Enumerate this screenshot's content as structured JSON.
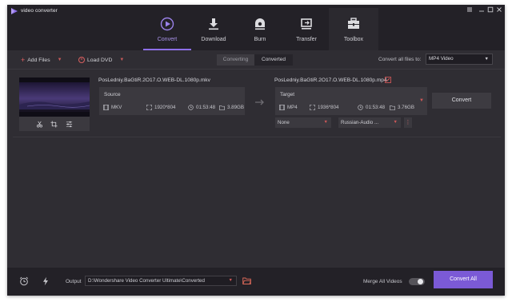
{
  "app": {
    "title": "video converter",
    "accent": "#8d6fe8"
  },
  "window_controls": {
    "menu_icon": "menu-icon",
    "minimize_icon": "minimize-icon",
    "maximize_icon": "maximize-icon",
    "close_icon": "close-icon"
  },
  "nav": {
    "tabs": [
      {
        "label": "Convert",
        "icon": "convert-icon",
        "active": true
      },
      {
        "label": "Download",
        "icon": "download-icon",
        "active": false
      },
      {
        "label": "Burn",
        "icon": "burn-icon",
        "active": false
      },
      {
        "label": "Transfer",
        "icon": "transfer-icon",
        "active": false
      },
      {
        "label": "Toolbox",
        "icon": "toolbox-icon",
        "active": false
      }
    ]
  },
  "toolbar": {
    "add_files": "Add Files",
    "load_dvd": "Load DVD",
    "seg_converting": "Converting",
    "seg_converted": "Converted",
    "convert_all_label": "Convert all files to:",
    "format": "MP4 Video"
  },
  "file": {
    "source_name": "PosLedniy.BaGtiR.2O17.O.WEB-DL.1080p.mkv",
    "target_name": "PosLedniy.BaGtiR.2O17.O.WEB-DL.1080p.mp4",
    "source": {
      "title": "Source",
      "format": "MKV",
      "resolution": "1920*804",
      "duration": "01:53:48",
      "size": "3.89GB"
    },
    "target": {
      "title": "Target",
      "format": "MP4",
      "resolution": "1936*804",
      "duration": "01:53:48",
      "size": "3.76GB"
    },
    "subtitle": "None",
    "audio": "Russian-Audio ...",
    "convert_button": "Convert"
  },
  "bottom": {
    "output_label": "Output",
    "output_path": "D:\\Wondershare Video Converter Ultimate\\Converted",
    "merge_label": "Merge All Videos",
    "merge_on": false,
    "convert_all_button": "Convert All"
  }
}
